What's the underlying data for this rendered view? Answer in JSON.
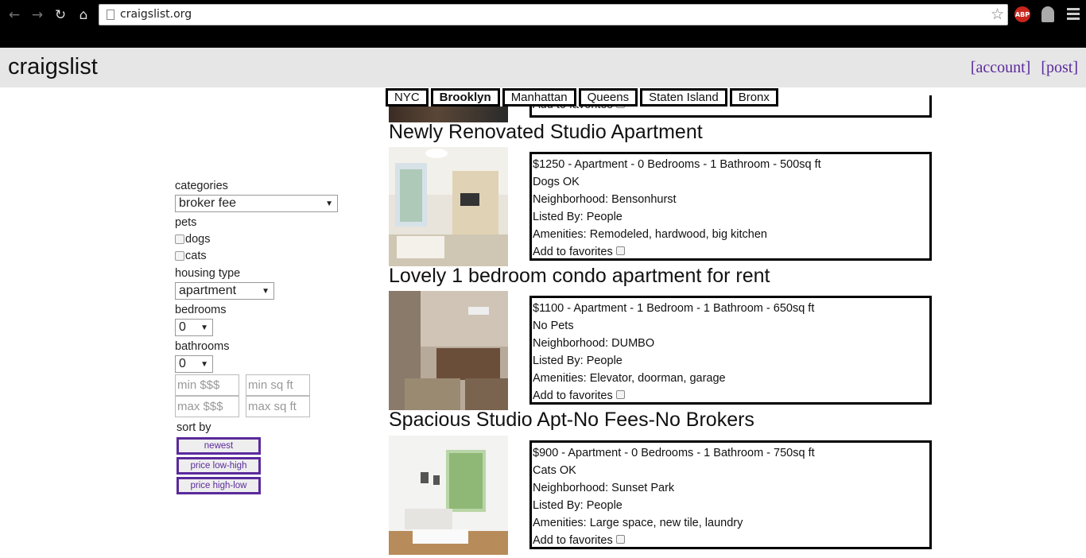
{
  "browser": {
    "url": "craigslist.org",
    "abp_label": "ABP"
  },
  "header": {
    "logo": "craigslist",
    "account_link": "[account]",
    "post_link": "[post]"
  },
  "locations": [
    "NYC",
    "Brooklyn",
    "Manhattan",
    "Queens",
    "Staten Island",
    "Bronx"
  ],
  "selected_location": "Brooklyn",
  "filters": {
    "categories_label": "categories",
    "categories_value": "broker fee",
    "pets_label": "pets",
    "pets_options": [
      "dogs",
      "cats"
    ],
    "housing_type_label": "housing type",
    "housing_type_value": "apartment",
    "bedrooms_label": "bedrooms",
    "bedrooms_value": "0",
    "bathrooms_label": "bathrooms",
    "bathrooms_value": "0",
    "min_price_placeholder": "min $$$",
    "min_sqft_placeholder": "min sq ft",
    "max_price_placeholder": "max $$$",
    "max_sqft_placeholder": "max sq ft",
    "sort_label": "sort by",
    "sort_options": [
      "newest",
      "price low-high",
      "price high-low"
    ]
  },
  "partial_listing": {
    "favorites_label": "Add to favorites"
  },
  "listings": [
    {
      "title": "Newly Renovated Studio Apartment",
      "summary": "$1250 - Apartment - 0 Bedrooms - 1 Bathroom - 500sq ft",
      "pets": "Dogs OK",
      "neighborhood": "Neighborhood: Bensonhurst",
      "listed_by": "Listed By: People",
      "amenities": "Amenities: Remodeled, hardwood, big kitchen",
      "favorites_label": "Add to favorites"
    },
    {
      "title": "Lovely 1 bedroom condo apartment for rent",
      "summary": "$1100 - Apartment - 1 Bedroom - 1 Bathroom - 650sq ft",
      "pets": "No Pets",
      "neighborhood": "Neighborhood: DUMBO",
      "listed_by": "Listed By: People",
      "amenities": "Amenities: Elevator, doorman, garage",
      "favorites_label": "Add to favorites"
    },
    {
      "title": "Spacious Studio Apt-No Fees-No Brokers",
      "summary": "$900 - Apartment - 0 Bedrooms - 1 Bathroom - 750sq ft",
      "pets": "Cats OK",
      "neighborhood": "Neighborhood: Sunset Park",
      "listed_by": "Listed By: People",
      "amenities": "Amenities: Large space, new tile, laundry",
      "favorites_label": "Add to favorites"
    }
  ]
}
